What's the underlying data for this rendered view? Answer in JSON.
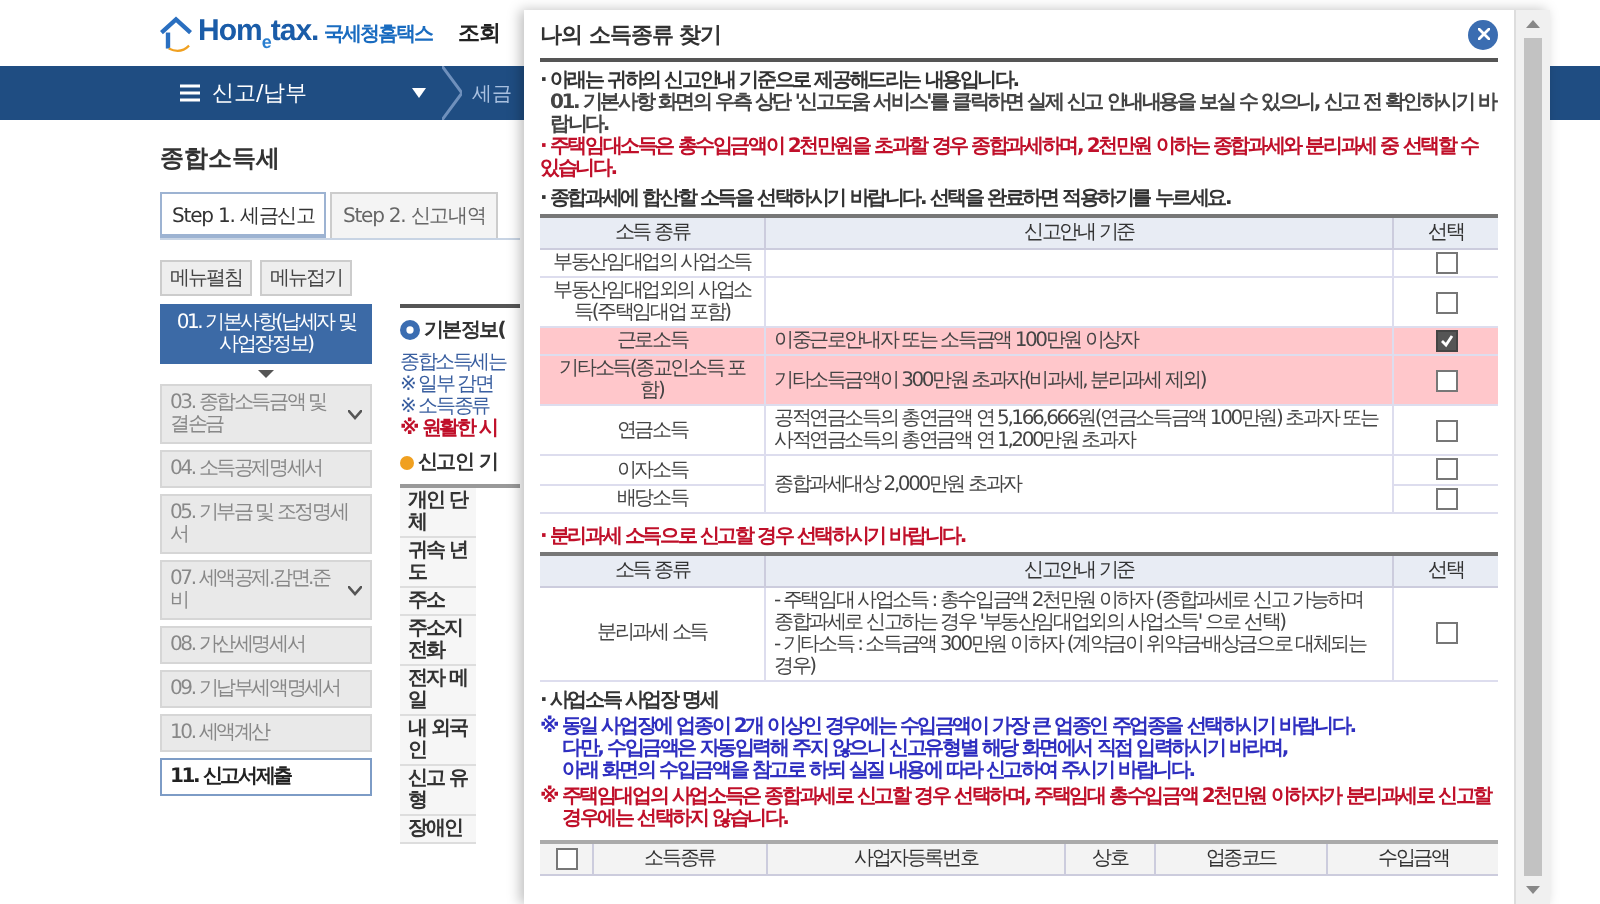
{
  "header": {
    "logo": "Hom$_{e}$tax.",
    "logo_subtitle": "국세청홈택스",
    "menu_item": "조회"
  },
  "nav": {
    "menu": "신고/납부",
    "breadcrumb": "세금"
  },
  "page_title": "종합소득세",
  "tabs": [
    {
      "label": "Step 1. 세금신고",
      "selected": true
    },
    {
      "label": "Step 2. 신고내역",
      "selected": false
    }
  ],
  "menu_buttons": [
    "메뉴펼침",
    "메뉴접기"
  ],
  "steps": [
    {
      "label": "01. 기본사항(납세자 및 사업장정보)",
      "selected": true,
      "focused": false,
      "expandable": false
    },
    {
      "label": "03. 종합소득금액 및 결손금",
      "selected": false,
      "focused": false,
      "expandable": true
    },
    {
      "label": "04. 소득공제명세서",
      "selected": false,
      "focused": false,
      "expandable": false
    },
    {
      "label": "05. 기부금 및 조정명세서",
      "selected": false,
      "focused": false,
      "expandable": false
    },
    {
      "label": "07. 세액공제.감면.준비",
      "selected": false,
      "focused": false,
      "expandable": true
    },
    {
      "label": "08. 가산세명세서",
      "selected": false,
      "focused": false,
      "expandable": false
    },
    {
      "label": "09. 기납부세액명세서",
      "selected": false,
      "focused": false,
      "expandable": false
    },
    {
      "label": "10. 세액계산",
      "selected": false,
      "focused": false,
      "expandable": false
    },
    {
      "label": "11. 신고서제출",
      "selected": false,
      "focused": true,
      "expandable": false
    }
  ],
  "basic_info": {
    "title": "기본정보(",
    "notes": [
      {
        "text": "종합소득세는",
        "kind": "info"
      },
      {
        "text": "※ 일부 감면",
        "kind": "info"
      },
      {
        "text": "※ 소득종류",
        "kind": "info"
      },
      {
        "text": "※ 원활한 시",
        "kind": "warning"
      }
    ],
    "subtitle": "신고인 기",
    "fields": [
      "개인 단체",
      "귀속 년도",
      "주소",
      "주소지 전화",
      "전자 메일",
      "내 외국인",
      "신고 유형",
      "장애인"
    ]
  },
  "dialog": {
    "title": "나의 소득종류 찾기",
    "notes": [
      {
        "text": "· 아래는 귀하의 신고안내 기준으로 제공해드리는 내용입니다.",
        "kind": "info"
      },
      {
        "text": "01. 기본사항 화면의 우측 상단 '신고도움 서비스'를 클릭하면 실제 신고 안내내용을 보실 수 있으니, 신고 전 확인하시기 바랍니다.",
        "kind": "continuation"
      },
      {
        "text": "· 주택임대소득은 총수입금액이 2천만원을 초과할 경우 종합과세하며, 2천만원 이하는 종합과세와 분리과세 중 선택할 수 있습니다.",
        "kind": "warning"
      }
    ],
    "combined": {
      "heading": "· 종합과세에 합산할 소득을 선택하시기 바랍니다. 선택을 완료하면 적용하기를 누르세요.",
      "columns": [
        "소득 종류",
        "신고안내 기준",
        "선택"
      ],
      "groups": [
        {
          "rows": [
            {
              "income_type": "부동산임대업의 사업소득",
              "checked": false,
              "highlighted": false
            }
          ]
        },
        {
          "rows": [
            {
              "income_type": "부동산임대업외의 사업소득(주택임대업 포함)",
              "checked": false,
              "highlighted": false
            }
          ]
        },
        {
          "criterion": "이중근로안내자 또는 소득금액 100만원 이상자",
          "rows": [
            {
              "income_type": "근로소득",
              "checked": true,
              "highlighted": true
            }
          ]
        },
        {
          "criterion": "기타소득금액이 300만원 초과자(비과세, 분리과세 제외)",
          "rows": [
            {
              "income_type": "기타소득(종교인소득 포함)",
              "checked": false,
              "highlighted": true
            }
          ]
        },
        {
          "criterion": "공적연금소득의 총연금액 연 5,166,666원(연금소득금액 100만원) 초과자 또는 사적연금소득의 총연금액 연 1,200만원 초과자",
          "rows": [
            {
              "income_type": "연금소득",
              "checked": false,
              "highlighted": false
            }
          ]
        },
        {
          "criterion": "종합과세대상 2,000만원 초과자",
          "rows": [
            {
              "income_type": "이자소득",
              "checked": false,
              "highlighted": false
            },
            {
              "income_type": "배당소득",
              "checked": false,
              "highlighted": false
            }
          ]
        }
      ]
    },
    "separate": {
      "heading": "· 분리과세 소득으로 신고할 경우 선택하시기 바랍니다.",
      "columns": [
        "소득 종류",
        "신고안내 기준",
        "선택"
      ],
      "rows": [
        {
          "income_type": "분리과세 소득",
          "criteria": [
            "- 주택임대 사업소득 : 총수입금액 2천만원 이하자 (종합과세로 신고 가능하며 종합과세로 신고하는 경우 '부동산임대업외의 사업소득' 으로 선택)",
            "- 기타소득 : 소득금액 300만원 이하자 (계약금이 위약금·배상금으로 대체되는 경우)"
          ],
          "checked": false
        }
      ]
    },
    "business": {
      "heading": "· 사업소득 사업장 명세",
      "notes": [
        {
          "lines": [
            "※ 동일 사업장에 업종이 2개 이상인 경우에는 수입금액이 가장 큰 업종인 주업종을 선택하시기 바랍니다.",
            "다만, 수입금액은 자동입력해 주지 않으니 신고유형별 해당 화면에서 직접 입력하시기 바라며,",
            "아래 화면의 수입금액을 참고로 하되 실질 내용에 따라 신고하여 주시기 바랍니다."
          ],
          "kind": "info"
        },
        {
          "lines": [
            "※ 주택임대업의 사업소득은 종합과세로 신고할 경우 선택하며, 주택임대 총수입금액 2천만원 이하자가 분리과세로 신고할 경우에는 선택하지 않습니다."
          ],
          "kind": "warning"
        }
      ],
      "all_checked": false,
      "columns": [
        "소득종류",
        "사업자등록번호",
        "상호",
        "업종코드",
        "수입금액"
      ]
    }
  }
}
